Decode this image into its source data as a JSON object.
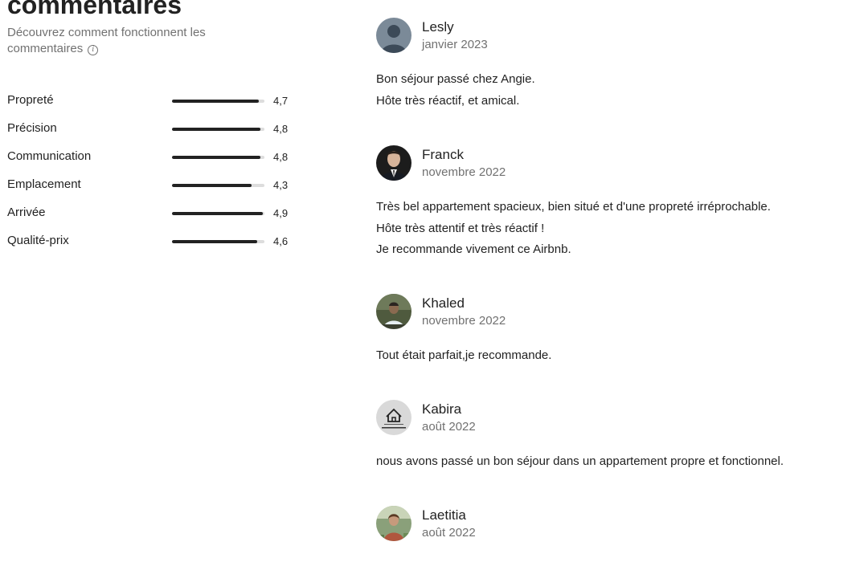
{
  "header": {
    "title": "commentaires",
    "subtitle": "Découvrez comment fonctionnent les commentaires",
    "info_icon": "info-circle-icon"
  },
  "ratings": [
    {
      "label": "Propreté",
      "value": "4,7",
      "score": 4.7
    },
    {
      "label": "Précision",
      "value": "4,8",
      "score": 4.8
    },
    {
      "label": "Communication",
      "value": "4,8",
      "score": 4.8
    },
    {
      "label": "Emplacement",
      "value": "4,3",
      "score": 4.3
    },
    {
      "label": "Arrivée",
      "value": "4,9",
      "score": 4.9
    },
    {
      "label": "Qualité-prix",
      "value": "4,6",
      "score": 4.6
    }
  ],
  "reviews": [
    {
      "name": "Lesly",
      "date": "janvier 2023",
      "avatar": "default-user-avatar",
      "lines": [
        "Bon séjour passé chez Angie.",
        "Hôte très réactif, et amical."
      ]
    },
    {
      "name": "Franck",
      "date": "novembre 2022",
      "avatar": "photo-avatar",
      "lines": [
        "Très bel appartement spacieux, bien situé et d'une propreté irréprochable.",
        "Hôte très attentif et très réactif !",
        "Je recommande vivement ce Airbnb."
      ]
    },
    {
      "name": "Khaled",
      "date": "novembre 2022",
      "avatar": "photo-avatar",
      "lines": [
        "Tout était parfait,je recommande."
      ]
    },
    {
      "name": "Kabira",
      "date": "août 2022",
      "avatar": "house-logo-avatar",
      "lines": [
        "nous avons passé un bon séjour dans un appartement propre et fonctionnel."
      ]
    },
    {
      "name": "Laetitia",
      "date": "août 2022",
      "avatar": "photo-avatar",
      "lines": []
    }
  ]
}
